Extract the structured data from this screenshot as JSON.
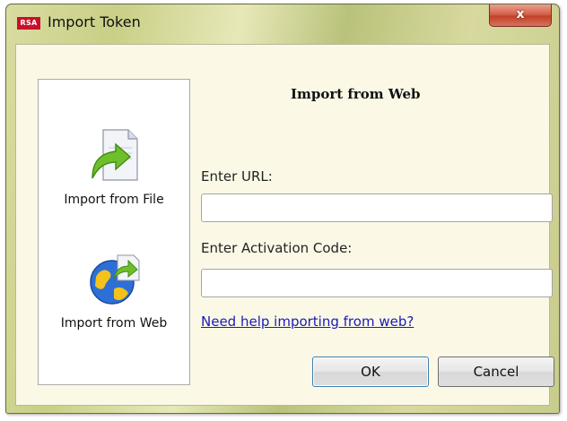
{
  "window": {
    "title": "Import Token",
    "app_logo": "RSA",
    "close_glyph": "x"
  },
  "sidebar": {
    "items": [
      {
        "label": "Import from File",
        "icon": "import-file-icon"
      },
      {
        "label": "Import from Web",
        "icon": "import-web-icon"
      }
    ]
  },
  "main": {
    "section_title": "Import from Web",
    "url_label": "Enter URL:",
    "url_value": "",
    "code_label": "Enter Activation Code:",
    "code_value": "",
    "help_link": "Need help importing from web?"
  },
  "buttons": {
    "ok": "OK",
    "cancel": "Cancel"
  },
  "colors": {
    "link": "#1a1ab8",
    "close_button": "#c4412a",
    "panel_bg": "#fbf9e6"
  }
}
